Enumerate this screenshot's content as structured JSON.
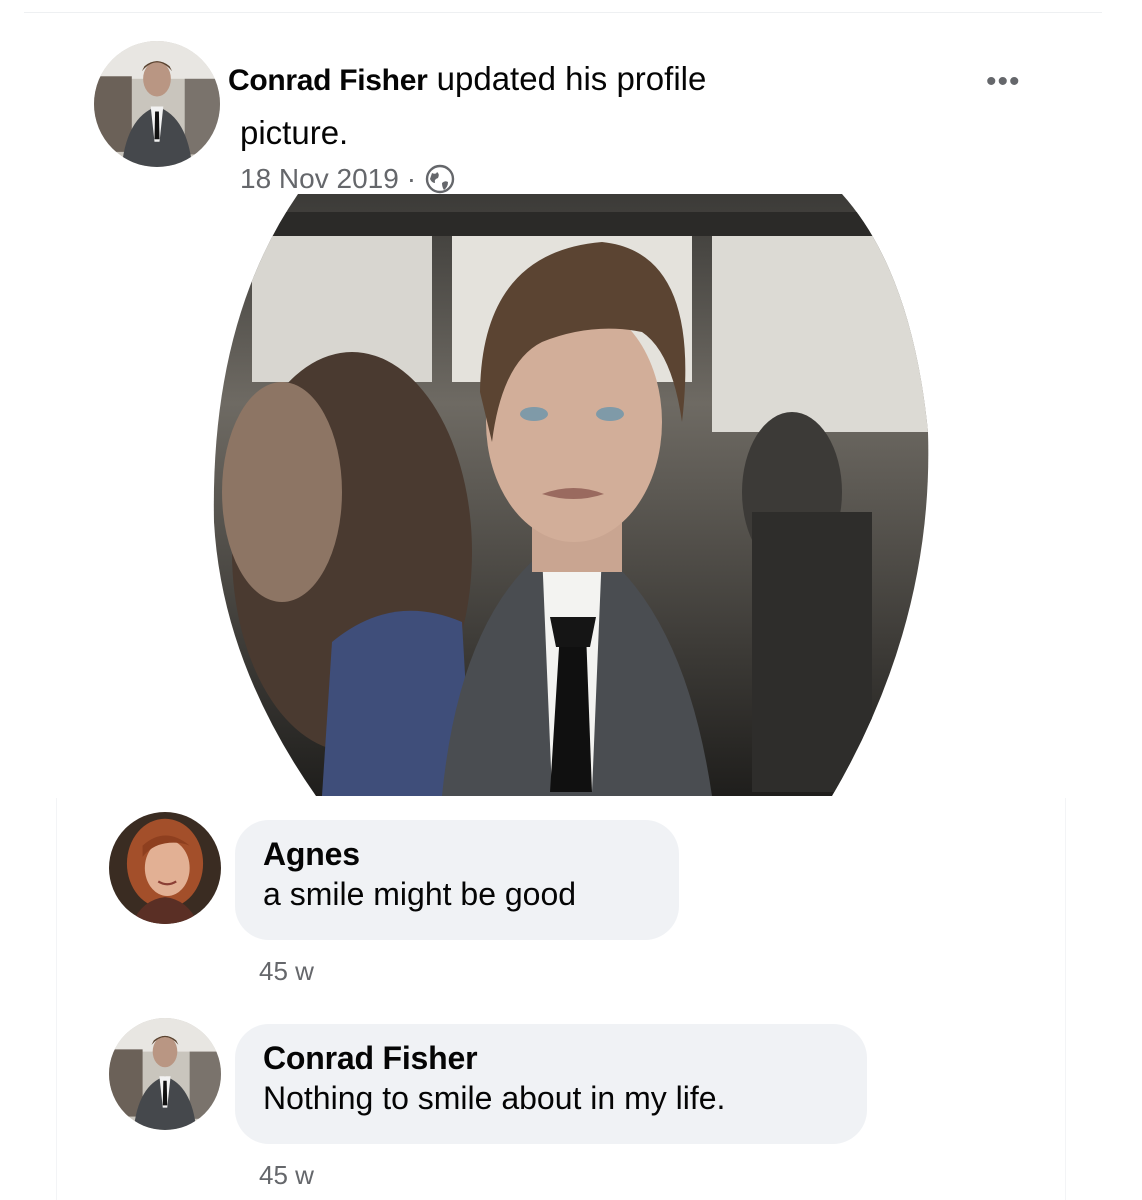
{
  "post": {
    "author": "Conrad Fisher",
    "action_line1": "updated his profile",
    "action_line2": "picture.",
    "date": "18 Nov 2019",
    "separator": "·",
    "privacy_icon": "globe-icon",
    "more_label": "•••"
  },
  "comments": [
    {
      "author": "Agnes",
      "text": "a smile might be good",
      "time": "45 w"
    },
    {
      "author": "Conrad Fisher",
      "text": "Nothing to smile about in my life.",
      "time": "45 w"
    }
  ],
  "colors": {
    "bubble": "#f0f2f5",
    "meta_text": "#65676b",
    "primary_text": "#050505"
  }
}
